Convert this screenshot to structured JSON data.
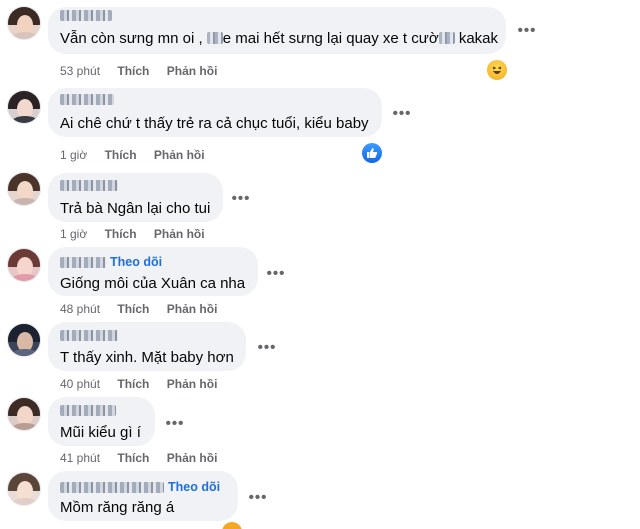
{
  "comments": [
    {
      "text_before": "Vẫn còn sưng mn oi ,",
      "text_mid": "e mai hết sưng lại quay xe t cườ",
      "text_after": "kakak",
      "time": "53 phút",
      "like": "Thích",
      "reply": "Phản hồi",
      "reaction": "haha-icon"
    },
    {
      "text": "Ai chê chứ t thấy trẻ ra cả chục tuổi, kiểu baby",
      "time": "1 giờ",
      "like": "Thích",
      "reply": "Phản hồi",
      "reaction": "like-icon"
    },
    {
      "text": "Trả bà Ngân lại cho tui",
      "time": "1 giờ",
      "like": "Thích",
      "reply": "Phản hồi"
    },
    {
      "follow": "Theo dõi",
      "text": "Giống môi của Xuân ca nha",
      "time": "48 phút",
      "like": "Thích",
      "reply": "Phản hồi"
    },
    {
      "text": "T thấy xinh. Mặt baby hơn",
      "time": "40 phút",
      "like": "Thích",
      "reply": "Phản hồi"
    },
    {
      "text": "Mũi kiểu gì í",
      "time": "41 phút",
      "like": "Thích",
      "reply": "Phản hồi"
    },
    {
      "follow": "Theo dõi",
      "text": "Mồm răng răng á"
    }
  ],
  "more_icon": "•••",
  "colors": {
    "bubble": "#f0f2f5",
    "follow": "#216fdb",
    "meta": "#65676b"
  }
}
